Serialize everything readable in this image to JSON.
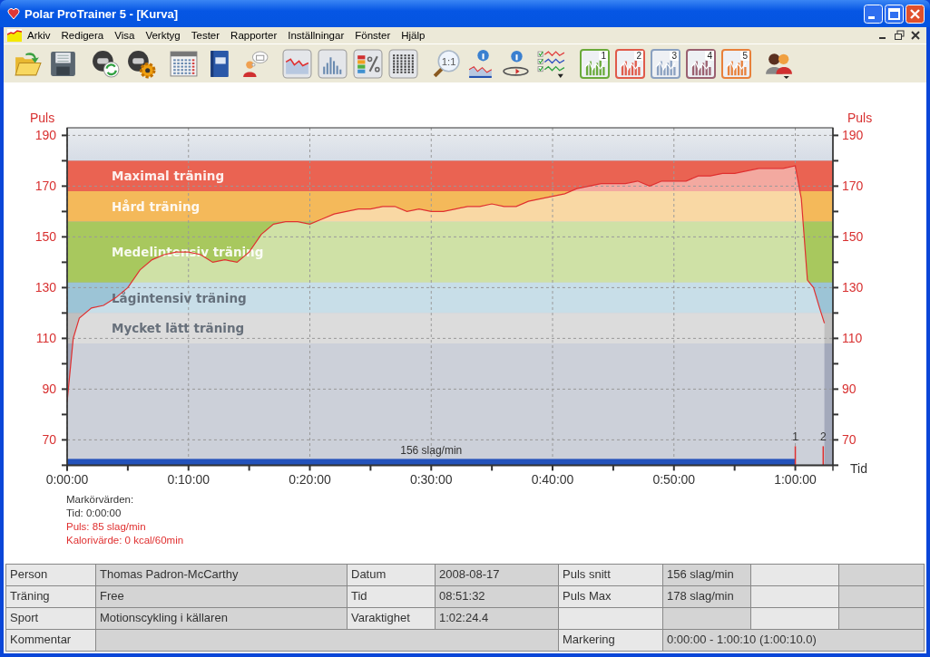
{
  "window": {
    "title": "Polar ProTrainer 5 - [Kurva]"
  },
  "menu": [
    "Arkiv",
    "Redigera",
    "Visa",
    "Verktyg",
    "Tester",
    "Rapporter",
    "Inställningar",
    "Fönster",
    "Hjälp"
  ],
  "toolbar": {
    "zoom_label": "1:1",
    "zone_views": [
      {
        "label": "1",
        "color": "#6aaa3a"
      },
      {
        "label": "2",
        "color": "#e05a4a"
      },
      {
        "label": "3",
        "color": "#8aa0c0"
      },
      {
        "label": "4",
        "color": "#9a6070"
      },
      {
        "label": "5",
        "color": "#e8803a"
      }
    ]
  },
  "curve": {
    "chart_data": {
      "type": "area",
      "ylabel": "Puls",
      "xlabel": "Tid",
      "x": [
        0,
        0.5,
        1,
        2,
        3,
        4,
        5,
        6,
        7,
        8,
        9,
        10,
        11,
        12,
        13,
        14,
        15,
        16,
        17,
        18,
        19,
        20,
        21,
        22,
        23,
        24,
        25,
        26,
        27,
        28,
        29,
        30,
        31,
        32,
        33,
        34,
        35,
        36,
        37,
        38,
        39,
        40,
        41,
        42,
        43,
        44,
        45,
        46,
        47,
        48,
        49,
        50,
        51,
        52,
        53,
        54,
        55,
        56,
        57,
        58,
        59,
        60,
        60.5,
        61,
        61.5,
        62,
        62.4
      ],
      "series": [
        {
          "color": "#e03030",
          "values": [
            85,
            110,
            118,
            122,
            123,
            126,
            130,
            137,
            141,
            143,
            144,
            144,
            143,
            140,
            141,
            140,
            144,
            151,
            155,
            156,
            156,
            155,
            157,
            159,
            160,
            161,
            161,
            162,
            162,
            160,
            161,
            160,
            160,
            161,
            162,
            162,
            163,
            162,
            162,
            164,
            165,
            166,
            167,
            169,
            170,
            171,
            171,
            171,
            172,
            170,
            172,
            172,
            172,
            174,
            174,
            175,
            175,
            176,
            177,
            177,
            177,
            178,
            165,
            133,
            130,
            122,
            116
          ]
        }
      ],
      "xlim": [
        0,
        63.1
      ],
      "ylim": [
        60,
        193
      ],
      "xticks": [
        {
          "value": 0,
          "label": "0:00:00"
        },
        {
          "value": 10,
          "label": "0:10:00"
        },
        {
          "value": 20,
          "label": "0:20:00"
        },
        {
          "value": 30,
          "label": "0:30:00"
        },
        {
          "value": 40,
          "label": "0:40:00"
        },
        {
          "value": 50,
          "label": "0:50:00"
        },
        {
          "value": 60,
          "label": "1:00:00"
        }
      ],
      "yticks": [
        {
          "value": 70,
          "label": "70"
        },
        {
          "value": 90,
          "label": "90"
        },
        {
          "value": 110,
          "label": "110"
        },
        {
          "value": 130,
          "label": "130"
        },
        {
          "value": 150,
          "label": "150"
        },
        {
          "value": 170,
          "label": "170"
        },
        {
          "value": 190,
          "label": "190"
        }
      ],
      "grid": true,
      "bands": [
        {
          "axis": "y",
          "label": "Maximal träning",
          "from": 168,
          "to": 180,
          "color": "#ea6352"
        },
        {
          "axis": "y",
          "label": "Hård träning",
          "from": 156,
          "to": 168,
          "color": "#f4b95a"
        },
        {
          "axis": "y",
          "label": "Medelintensiv träning",
          "from": 132,
          "to": 156,
          "color": "#a8c85e"
        },
        {
          "axis": "y",
          "label": "Lågintensiv träning",
          "from": 120,
          "to": 132,
          "color": "#9cc4d6"
        },
        {
          "axis": "y",
          "label": "Mycket lätt träning",
          "from": 108,
          "to": 120,
          "color": "#c0c0c0"
        }
      ],
      "annotations": [
        {
          "text": "1",
          "x": 60
        },
        {
          "text": "2",
          "x": 62.3
        }
      ]
    },
    "selection": {
      "label": "156 slag/min",
      "color": "#2352bb"
    },
    "right_axis": {
      "label": "Puls",
      "ticks": [
        "190",
        "170",
        "150",
        "130",
        "110",
        "90",
        "70"
      ]
    }
  },
  "marker_values": {
    "title": "Markörvärden:",
    "lines": [
      {
        "text": "Tid: 0:00:00",
        "color": "#333333"
      },
      {
        "text": "Puls: 85 slag/min",
        "color": "#e03030"
      },
      {
        "text": "Kalorivärde: 0 kcal/60min",
        "color": "#e03030"
      }
    ]
  },
  "info_table": {
    "rows": [
      {
        "kind": "normal",
        "pairs": [
          {
            "label": "Person",
            "value": "Thomas Padron-McCarthy"
          },
          {
            "label": "Datum",
            "value": "2008-08-17"
          },
          {
            "label": "Puls snitt",
            "value": "156 slag/min"
          }
        ]
      },
      {
        "kind": "normal",
        "pairs": [
          {
            "label": "Träning",
            "value": "Free"
          },
          {
            "label": "Tid",
            "value": "08:51:32"
          },
          {
            "label": "Puls Max",
            "value": "178 slag/min"
          }
        ]
      },
      {
        "kind": "normal",
        "pairs": [
          {
            "label": "Sport",
            "value": "Motionscykling i källaren"
          },
          {
            "label": "Varaktighet",
            "value": "1:02:24.4"
          }
        ]
      },
      {
        "kind": "wide",
        "pairs": [
          {
            "label": "Kommentar"
          },
          {
            "label": "Markering",
            "value": "0:00:00 - 1:00:10 (1:00:10.0)"
          }
        ]
      }
    ]
  }
}
